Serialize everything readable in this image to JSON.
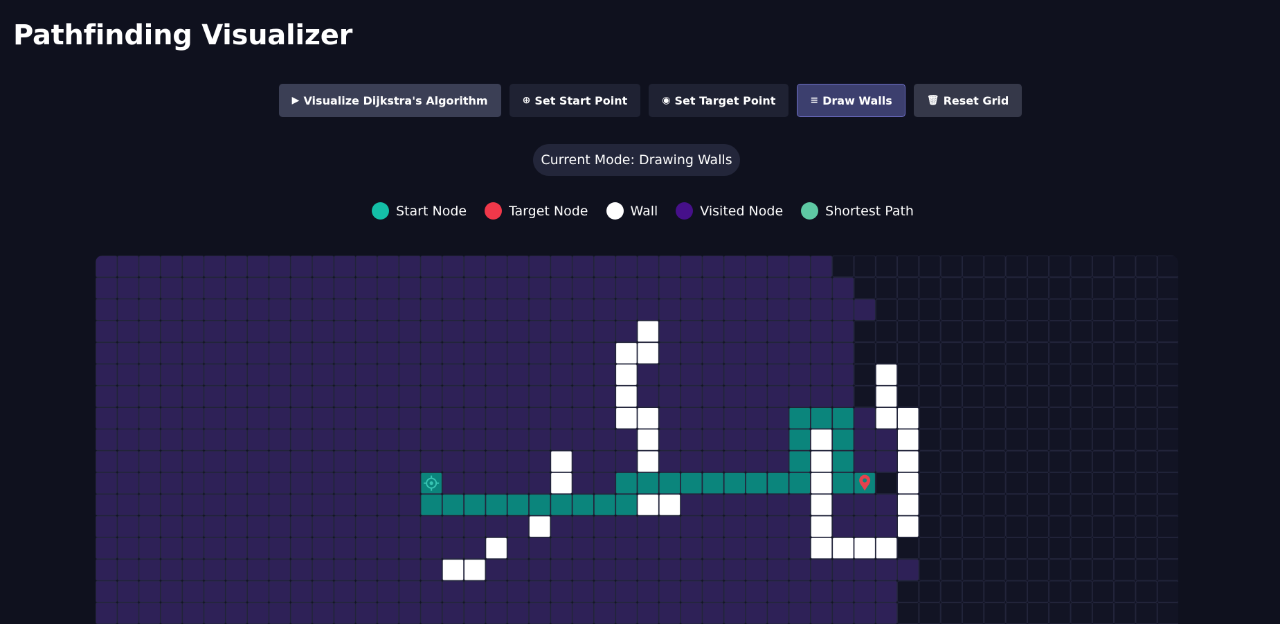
{
  "app": {
    "title": "Pathfinding Visualizer"
  },
  "toolbar": {
    "buttons": [
      {
        "id": "visualize",
        "icon": "▶",
        "label": "Visualize Dijkstra's Algorithm",
        "state": "normal"
      },
      {
        "id": "set-start",
        "icon": "⊕",
        "label": "Set Start Point",
        "state": "normal"
      },
      {
        "id": "set-target",
        "icon": "◉",
        "label": "Set Target Point",
        "state": "normal"
      },
      {
        "id": "draw-walls",
        "icon": "≡",
        "label": "Draw Walls",
        "state": "active"
      },
      {
        "id": "reset",
        "icon": "🗑",
        "label": "Reset Grid",
        "state": "normal"
      }
    ]
  },
  "status": {
    "mode_text": "Current Mode: Drawing Walls"
  },
  "legend": [
    {
      "label": "Start Node",
      "color": "#14bfa7"
    },
    {
      "label": "Target Node",
      "color": "#f0384a"
    },
    {
      "label": "Wall",
      "color": "#ffffff"
    },
    {
      "label": "Visited Node",
      "color": "#46108a"
    },
    {
      "label": "Shortest Path",
      "color": "#5ec9a4"
    }
  ],
  "colors": {
    "unvisited": "#121424",
    "visited": "#2e2157",
    "wall": "#ffffff",
    "path": "#0b857c",
    "start_icon": "#38c5b3",
    "target_icon": "#e5424d",
    "cell_border": "#262840"
  },
  "grid": {
    "cols": 50,
    "rows": 17,
    "visible_rows": 17,
    "start": [
      15,
      10
    ],
    "target": [
      35,
      10
    ],
    "visited_extent_per_row": [
      34,
      35,
      36,
      35,
      35,
      35,
      35,
      37,
      37,
      37,
      36,
      37,
      37,
      37,
      38,
      37,
      37
    ],
    "walls": [
      [
        25,
        3
      ],
      [
        24,
        4
      ],
      [
        25,
        4
      ],
      [
        24,
        5
      ],
      [
        36,
        5
      ],
      [
        24,
        6
      ],
      [
        36,
        6
      ],
      [
        24,
        7
      ],
      [
        25,
        7
      ],
      [
        36,
        7
      ],
      [
        37,
        7
      ],
      [
        25,
        8
      ],
      [
        33,
        8
      ],
      [
        37,
        8
      ],
      [
        21,
        9
      ],
      [
        25,
        9
      ],
      [
        33,
        9
      ],
      [
        37,
        9
      ],
      [
        21,
        10
      ],
      [
        33,
        10
      ],
      [
        37,
        10
      ],
      [
        25,
        11
      ],
      [
        26,
        11
      ],
      [
        33,
        11
      ],
      [
        37,
        11
      ],
      [
        20,
        12
      ],
      [
        33,
        12
      ],
      [
        37,
        12
      ],
      [
        18,
        13
      ],
      [
        33,
        13
      ],
      [
        34,
        13
      ],
      [
        35,
        13
      ],
      [
        36,
        13
      ],
      [
        16,
        14
      ],
      [
        17,
        14
      ]
    ],
    "path": [
      [
        32,
        7
      ],
      [
        33,
        7
      ],
      [
        34,
        7
      ],
      [
        32,
        8
      ],
      [
        34,
        8
      ],
      [
        32,
        9
      ],
      [
        34,
        9
      ],
      [
        24,
        10
      ],
      [
        25,
        10
      ],
      [
        26,
        10
      ],
      [
        27,
        10
      ],
      [
        28,
        10
      ],
      [
        29,
        10
      ],
      [
        30,
        10
      ],
      [
        31,
        10
      ],
      [
        32,
        10
      ],
      [
        34,
        10
      ],
      [
        15,
        11
      ],
      [
        16,
        11
      ],
      [
        17,
        11
      ],
      [
        18,
        11
      ],
      [
        19,
        11
      ],
      [
        20,
        11
      ],
      [
        21,
        11
      ],
      [
        22,
        11
      ],
      [
        23,
        11
      ],
      [
        24,
        11
      ]
    ]
  }
}
